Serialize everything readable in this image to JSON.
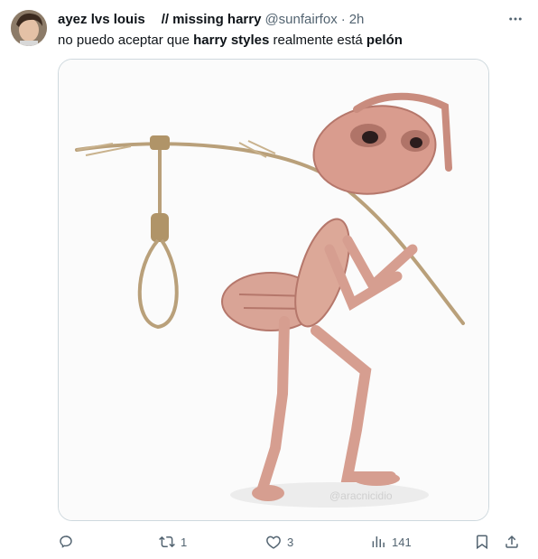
{
  "tweet": {
    "display_name": "ayez lvs louis",
    "sep": "//",
    "secondary_name": "missing harry",
    "handle": "@sunfairfox",
    "dot": "·",
    "time": "2h",
    "text_parts": [
      "no puedo aceptar que ",
      "harry styles",
      " realmente está ",
      "pelón"
    ]
  },
  "media": {
    "watermark": "@aracnicidio"
  },
  "actions": {
    "reply_count": "",
    "retweet_count": "1",
    "like_count": "3",
    "views_count": "141"
  },
  "icons": {
    "more": "more-icon",
    "reply": "reply-icon",
    "retweet": "retweet-icon",
    "like": "heart-icon",
    "views": "views-icon",
    "bookmark": "bookmark-icon",
    "share": "share-icon"
  },
  "colors": {
    "text": "#0f1419",
    "secondary": "#536471",
    "border": "#cfd9de"
  }
}
